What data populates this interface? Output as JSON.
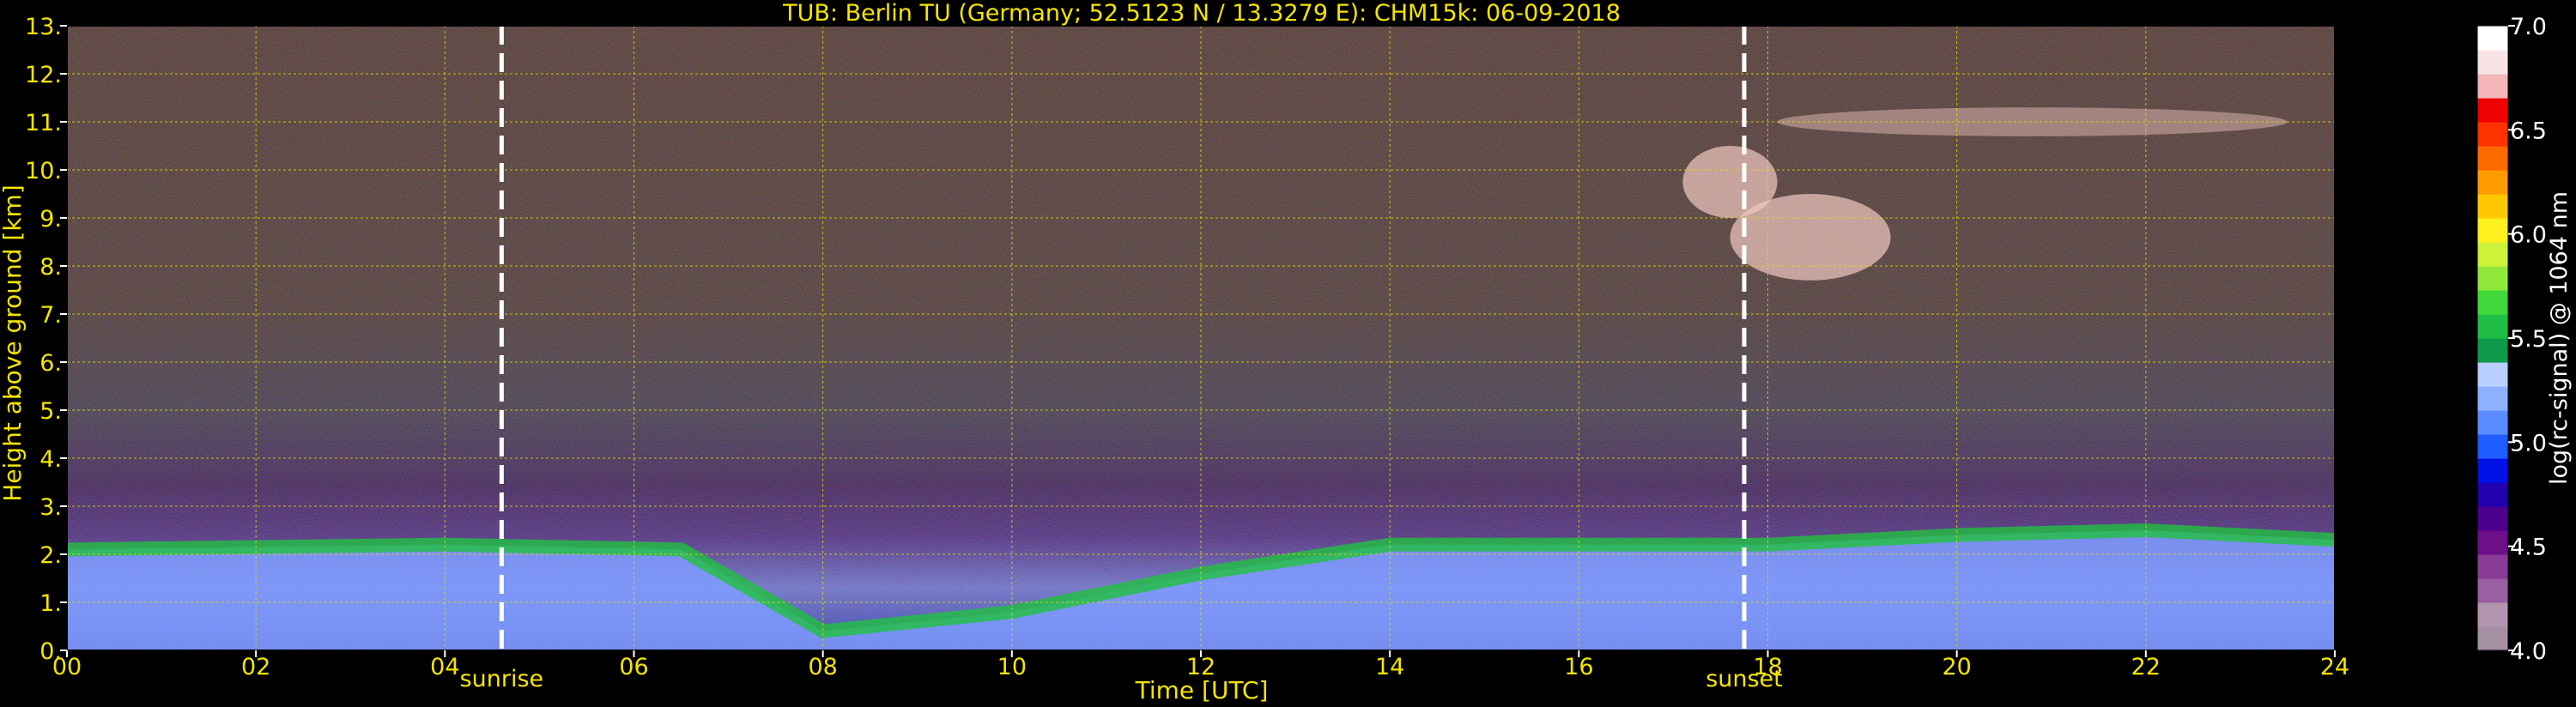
{
  "chart_data": {
    "type": "heatmap",
    "title": "TUB: Berlin TU (Germany; 52.5123 N / 13.3279 E):    CHM15k: 06-09-2018",
    "xlabel": "Time [UTC]",
    "ylabel": "Height above ground [km]",
    "colorbar_label": "log(rc-signal) @ 1064 nm",
    "xlim": [
      0,
      24
    ],
    "ylim": [
      0,
      13
    ],
    "x_ticks": [
      0,
      2,
      4,
      6,
      8,
      10,
      12,
      14,
      16,
      18,
      20,
      22,
      24
    ],
    "x_tick_labels": [
      "00",
      "02",
      "04",
      "06",
      "08",
      "10",
      "12",
      "14",
      "16",
      "18",
      "20",
      "22",
      "24"
    ],
    "y_ticks": [
      0,
      1,
      2,
      3,
      4,
      5,
      6,
      7,
      8,
      9,
      10,
      11,
      12,
      13
    ],
    "y_tick_labels": [
      "0.",
      "1.",
      "2.",
      "3.",
      "4.",
      "5.",
      "6.",
      "7.",
      "8.",
      "9.",
      "10.",
      "11.",
      "12.",
      "13."
    ],
    "grid": true,
    "colorbar": {
      "min": 4.0,
      "max": 7.0,
      "ticks": [
        4.0,
        4.5,
        5.0,
        5.5,
        6.0,
        6.5,
        7.0
      ],
      "tick_labels": [
        "4.0",
        "4.5",
        "5.0",
        "5.5",
        "6.0",
        "6.5",
        "7.0"
      ],
      "colors": [
        "#a690a4",
        "#b495b0",
        "#9a5fa0",
        "#8a3b96",
        "#6e0f8a",
        "#4d008c",
        "#2100b0",
        "#0010e6",
        "#1f5cff",
        "#5b8cff",
        "#8fb0ff",
        "#b9cfff",
        "#0f9a4a",
        "#1fbf45",
        "#3fd93a",
        "#8fe83a",
        "#cdf23a",
        "#fff01f",
        "#ffc800",
        "#ff9a00",
        "#ff6a00",
        "#ff3300",
        "#f00000",
        "#f4b6b8",
        "#f8e4e6",
        "#ffffff"
      ]
    },
    "markers": [
      {
        "label": "sunrise",
        "x": 4.6
      },
      {
        "label": "sunset",
        "x": 17.75
      }
    ],
    "features": {
      "boundary_layer_top": [
        {
          "x": 0,
          "y": 2.1
        },
        {
          "x": 4,
          "y": 2.2
        },
        {
          "x": 6.5,
          "y": 2.1
        },
        {
          "x": 8,
          "y": 0.4
        },
        {
          "x": 10,
          "y": 0.8
        },
        {
          "x": 12,
          "y": 1.6
        },
        {
          "x": 14,
          "y": 2.2
        },
        {
          "x": 16,
          "y": 2.2
        },
        {
          "x": 18,
          "y": 2.2
        },
        {
          "x": 20,
          "y": 2.4
        },
        {
          "x": 22,
          "y": 2.5
        },
        {
          "x": 24,
          "y": 2.3
        }
      ],
      "clouds": [
        {
          "x0": 17.1,
          "x1": 18.1,
          "y0": 9.0,
          "y1": 10.5
        },
        {
          "x0": 17.6,
          "x1": 19.3,
          "y0": 7.7,
          "y1": 9.5
        },
        {
          "x0": 18.1,
          "x1": 23.5,
          "y0": 10.7,
          "y1": 11.3
        }
      ]
    }
  }
}
